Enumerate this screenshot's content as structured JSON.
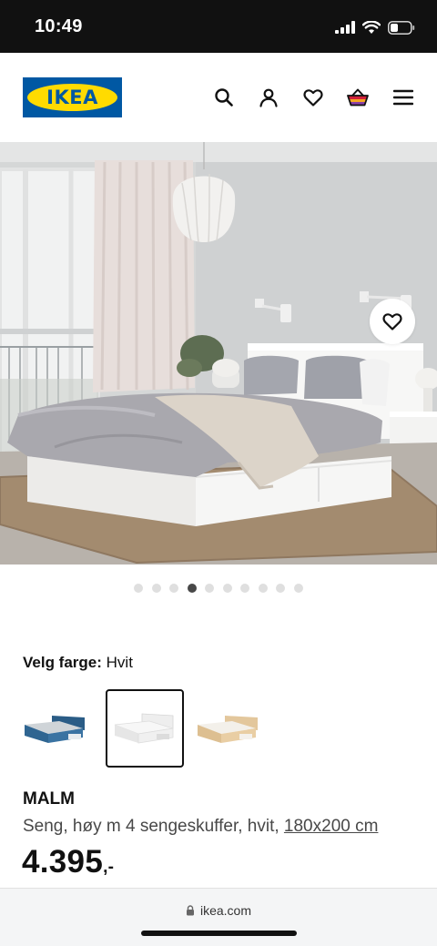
{
  "status_bar": {
    "time": "10:49"
  },
  "header": {
    "logo_text": "IKEA",
    "icons": [
      "search-icon",
      "account-icon",
      "heart-icon",
      "basket-icon",
      "menu-icon"
    ]
  },
  "carousel": {
    "total": 10,
    "active_index": 3
  },
  "color": {
    "label": "Velg farge:",
    "value": "Hvit",
    "swatches": [
      "blue-bed",
      "white-bed",
      "oak-veneer-bed"
    ],
    "selected_index": 1
  },
  "product": {
    "name": "MALM",
    "description": "Seng, høy m 4 sengeskuffer, hvit,",
    "size": "180x200 cm",
    "price": "4.395",
    "price_suffix": ",-"
  },
  "browser": {
    "url": "ikea.com"
  },
  "colors": {
    "ikea_blue": "#0058a3",
    "ikea_yellow": "#ffdb00",
    "text": "#111111",
    "muted_text": "#484848"
  }
}
